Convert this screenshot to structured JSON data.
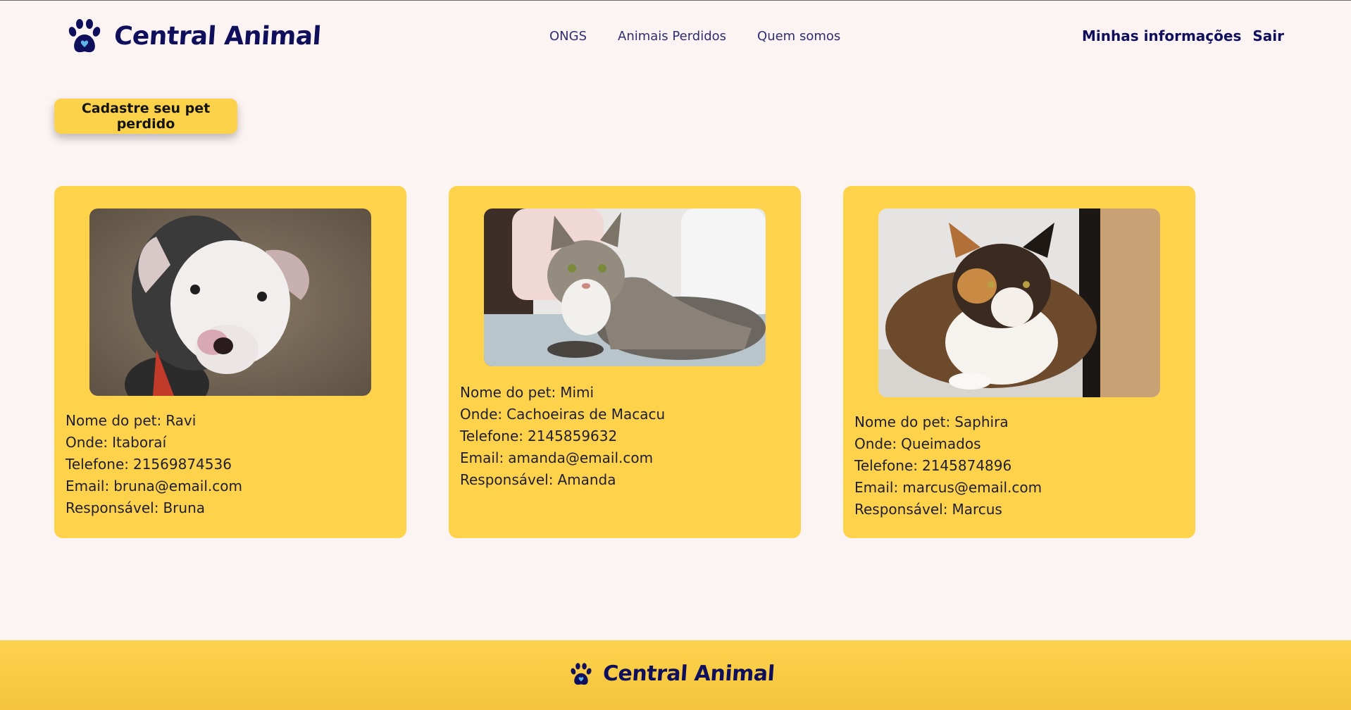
{
  "brand": {
    "name": "Central Animal",
    "primary_color": "#0f0f5c",
    "accent_color": "#ffd24c"
  },
  "nav": {
    "items": [
      "ONGS",
      "Animais Perdidos",
      "Quem somos"
    ]
  },
  "user_nav": {
    "profile": "Minhas informações",
    "logout": "Sair"
  },
  "register_button": "Cadastre seu pet perdido",
  "labels": {
    "name": "Nome do pet:",
    "location": "Onde:",
    "phone": "Telefone:",
    "email": "Email:",
    "owner": "Responsável:"
  },
  "pets": [
    {
      "name": "Ravi",
      "location": "Itaboraí",
      "phone": "21569874536",
      "email": "bruna@email.com",
      "owner": "Bruna",
      "photo": "white-pitbull-puppy-photo"
    },
    {
      "name": "Mimi",
      "location": "Cachoeiras de Macacu",
      "phone": "2145859632",
      "email": "amanda@email.com",
      "owner": "Amanda",
      "photo": "tabby-cat-photo"
    },
    {
      "name": "Saphira",
      "location": "Queimados",
      "phone": "2145874896",
      "email": "marcus@email.com",
      "owner": "Marcus",
      "photo": "calico-cat-photo"
    }
  ],
  "footer": {
    "brand": "Central Animal"
  }
}
